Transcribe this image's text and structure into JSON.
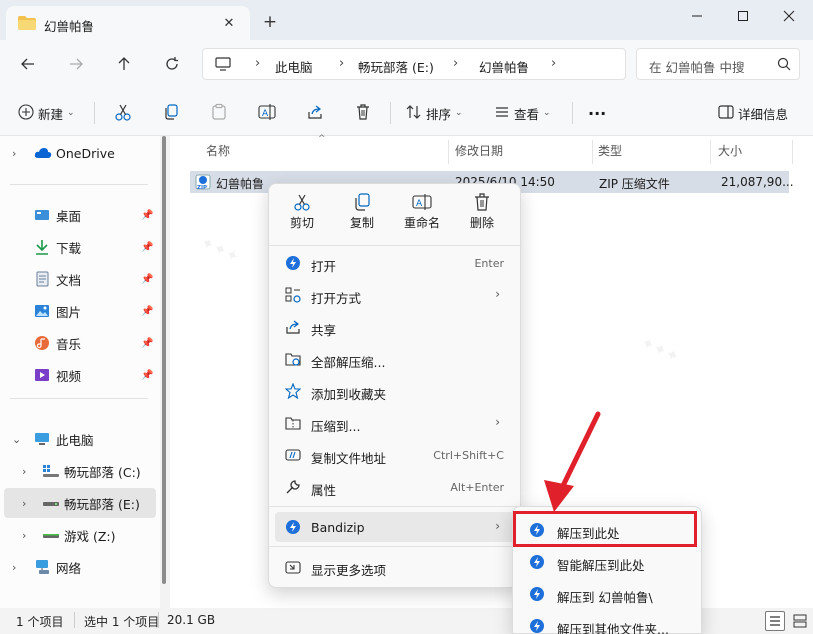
{
  "window": {
    "tab_title": "幻兽帕鲁",
    "close_tab": "✕",
    "new_tab": "+"
  },
  "address": {
    "breadcrumbs": [
      "此电脑",
      "畅玩部落 (E:)",
      "幻兽帕鲁"
    ],
    "search_placeholder": "在 幻兽帕鲁 中搜"
  },
  "toolbar": {
    "new_label": "新建",
    "sort_label": "排序",
    "view_label": "查看",
    "more_label": "···",
    "details_label": "详细信息"
  },
  "sidebar": {
    "onedrive": "OneDrive",
    "quick": [
      "桌面",
      "下载",
      "文档",
      "图片",
      "音乐",
      "视频"
    ],
    "this_pc": "此电脑",
    "drives": [
      "畅玩部落 (C:)",
      "畅玩部落 (E:)",
      "游戏 (Z:)"
    ],
    "network": "网络"
  },
  "columns": {
    "name": "名称",
    "modified": "修改日期",
    "type": "类型",
    "size": "大小"
  },
  "file": {
    "name": "幻兽帕鲁",
    "modified": "2025/6/10 14:50",
    "type": "ZIP 压缩文件",
    "size": "21,087,90..."
  },
  "status": {
    "count": "1 个项目",
    "selected": "选中 1 个项目",
    "size": "20.1 GB"
  },
  "context_menu": {
    "quick_actions": [
      "剪切",
      "复制",
      "重命名",
      "删除"
    ],
    "items": [
      {
        "label": "打开",
        "shortcut": "Enter"
      },
      {
        "label": "打开方式",
        "arrow": "›"
      },
      {
        "label": "共享"
      },
      {
        "label": "全部解压缩..."
      },
      {
        "label": "添加到收藏夹"
      },
      {
        "label": "压缩到...",
        "arrow": "›"
      },
      {
        "label": "复制文件地址",
        "shortcut": "Ctrl+Shift+C"
      },
      {
        "label": "属性",
        "shortcut": "Alt+Enter"
      },
      {
        "label": "Bandizip",
        "arrow": "›"
      },
      {
        "label": "显示更多选项"
      }
    ]
  },
  "submenu": {
    "items": [
      "解压到此处",
      "智能解压到此处",
      "解压到 幻兽帕鲁\\",
      "解压到其他文件夹..."
    ]
  },
  "colors": {
    "accent": "#0067c0",
    "bandizip_blue": "#1e6fd9",
    "highlight_red": "#e0202a",
    "selection": "#d7dde6"
  }
}
